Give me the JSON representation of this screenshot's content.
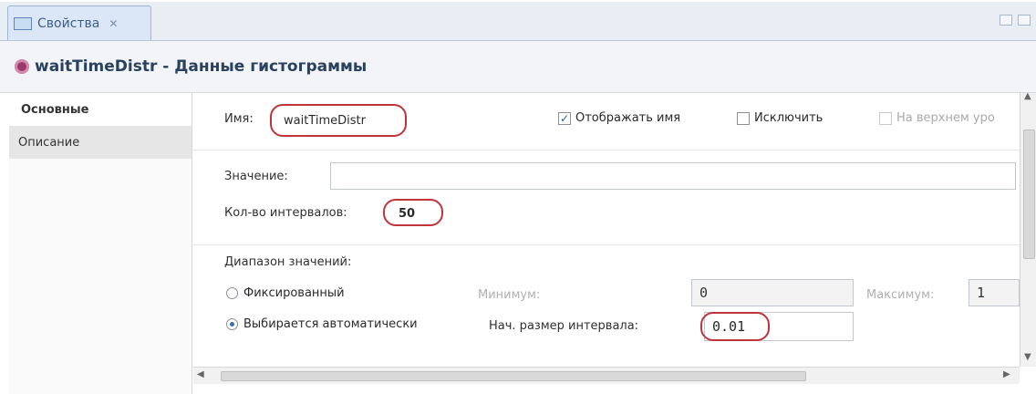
{
  "tab": {
    "label": "Свойства"
  },
  "header": {
    "object_name": "waitTimeDistr",
    "separator": " - ",
    "section_title": "Данные гистограммы"
  },
  "sidebar": {
    "items": [
      {
        "label": "Основные"
      },
      {
        "label": "Описание"
      }
    ]
  },
  "general": {
    "name_label": "Имя:",
    "name_value": "waitTimeDistr",
    "show_name_label": "Отображать имя",
    "show_name_checked": true,
    "exclude_label": "Исключить",
    "exclude_checked": false,
    "top_level_label": "На верхнем уро"
  },
  "value_section": {
    "value_label": "Значение:",
    "value_value": "",
    "intervals_label": "Кол-во интервалов:",
    "intervals_value": "50"
  },
  "range_section": {
    "heading": "Диапазон значений:",
    "fixed_label": "Фиксированный",
    "auto_label": "Выбирается автоматически",
    "selected": "auto",
    "minimum_label": "Минимум:",
    "minimum_value": "0",
    "maximum_label": "Максимум:",
    "maximum_value": "1",
    "initial_interval_label": "Нач. размер интервала:",
    "initial_interval_value": "0.01"
  },
  "colors": {
    "highlight_oval": "#c0343c",
    "header_text": "#27415f"
  }
}
